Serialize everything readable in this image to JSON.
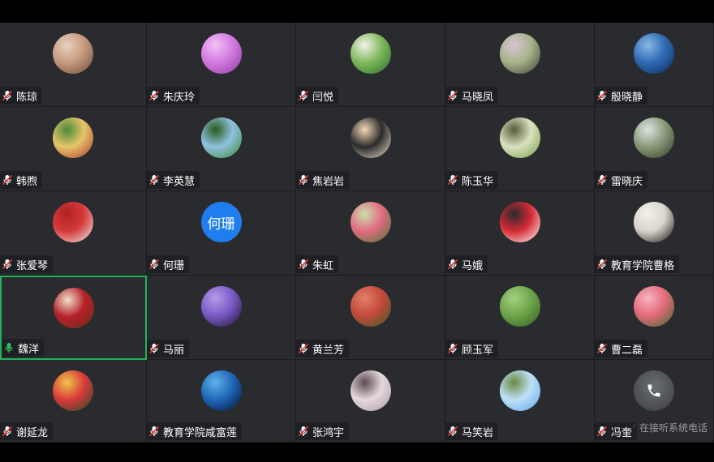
{
  "participants": [
    {
      "name": "陈琼",
      "avatar": {
        "type": "image",
        "colors": [
          "#6b4a3a",
          "#c79a7e",
          "#e8d2c0"
        ]
      },
      "mic": "muted"
    },
    {
      "name": "朱庆玲",
      "avatar": {
        "type": "image",
        "colors": [
          "#8a3aa0",
          "#d37ae0",
          "#f2c2f7"
        ]
      },
      "mic": "muted"
    },
    {
      "name": "闫悦",
      "avatar": {
        "type": "image",
        "colors": [
          "#2b6a2a",
          "#7fb95c",
          "#f4f2ea"
        ]
      },
      "mic": "muted"
    },
    {
      "name": "马晓凤",
      "avatar": {
        "type": "image",
        "colors": [
          "#3a3a3a",
          "#a7b48a",
          "#d8c4d6"
        ]
      },
      "mic": "muted"
    },
    {
      "name": "殷晓静",
      "avatar": {
        "type": "image",
        "colors": [
          "#0b2a5a",
          "#2f6bb3",
          "#89b9e4"
        ]
      },
      "mic": "muted"
    },
    {
      "name": "韩煦",
      "avatar": {
        "type": "image",
        "colors": [
          "#a9382c",
          "#e6c56a",
          "#4c8a3a"
        ]
      },
      "mic": "muted"
    },
    {
      "name": "李英慧",
      "avatar": {
        "type": "image",
        "colors": [
          "#3d8a2b",
          "#8ec1e0",
          "#2a5a1a"
        ]
      },
      "mic": "muted"
    },
    {
      "name": "焦岩岩",
      "avatar": {
        "type": "image",
        "colors": [
          "#f3e4cc",
          "#2b2b2b",
          "#f6d8b8"
        ]
      },
      "mic": "muted"
    },
    {
      "name": "陈玉华",
      "avatar": {
        "type": "image",
        "colors": [
          "#7a9a42",
          "#d9e3c1",
          "#5a5a3a"
        ]
      },
      "mic": "muted"
    },
    {
      "name": "雷晓庆",
      "avatar": {
        "type": "image",
        "colors": [
          "#2c3a22",
          "#8b9a7a",
          "#dbe4e0"
        ]
      },
      "mic": "muted"
    },
    {
      "name": "张爱琴",
      "avatar": {
        "type": "image",
        "colors": [
          "#f1f1f1",
          "#d43a3a",
          "#b02222"
        ]
      },
      "mic": "muted"
    },
    {
      "name": "何珊",
      "avatar": {
        "type": "text",
        "text": "何珊",
        "bg": "#1e7ef0"
      },
      "mic": "muted"
    },
    {
      "name": "朱虹",
      "avatar": {
        "type": "image",
        "colors": [
          "#3e7a2e",
          "#e36a82",
          "#c9e2b0"
        ]
      },
      "mic": "muted"
    },
    {
      "name": "马娥",
      "avatar": {
        "type": "image",
        "colors": [
          "#ffffff",
          "#d52a35",
          "#2b2b2b"
        ]
      },
      "mic": "muted"
    },
    {
      "name": "教育学院曹格",
      "avatar": {
        "type": "image",
        "colors": [
          "#101010",
          "#d9d4cc",
          "#f4f1ec"
        ]
      },
      "mic": "muted"
    },
    {
      "name": "魏洋",
      "avatar": {
        "type": "image",
        "colors": [
          "#6a2f18",
          "#b3202a",
          "#f0e0c8"
        ]
      },
      "mic": "active",
      "active": true
    },
    {
      "name": "马丽",
      "avatar": {
        "type": "image",
        "colors": [
          "#1d1330",
          "#7a5bc6",
          "#b49be8"
        ]
      },
      "mic": "muted"
    },
    {
      "name": "黄兰芳",
      "avatar": {
        "type": "image",
        "colors": [
          "#385a22",
          "#c44a3a",
          "#e27f6a"
        ]
      },
      "mic": "muted"
    },
    {
      "name": "顾玉军",
      "avatar": {
        "type": "image",
        "colors": [
          "#2f5d22",
          "#6ea64a",
          "#a4cf82"
        ]
      },
      "mic": "muted"
    },
    {
      "name": "曹二磊",
      "avatar": {
        "type": "image",
        "colors": [
          "#3a6a2e",
          "#e46a7a",
          "#f5b4c0"
        ]
      },
      "mic": "muted"
    },
    {
      "name": "谢延龙",
      "avatar": {
        "type": "image",
        "colors": [
          "#214a28",
          "#d93a3a",
          "#f0c44a"
        ]
      },
      "mic": "muted"
    },
    {
      "name": "教育学院咸富莲",
      "avatar": {
        "type": "image",
        "colors": [
          "#04102e",
          "#1f67b8",
          "#62b2ea"
        ]
      },
      "mic": "muted"
    },
    {
      "name": "张鸿宇",
      "avatar": {
        "type": "image",
        "colors": [
          "#a89aa4",
          "#e5d8dc",
          "#5a4a52"
        ]
      },
      "mic": "muted"
    },
    {
      "name": "马笑岩",
      "avatar": {
        "type": "image",
        "colors": [
          "#5aa5e8",
          "#bfe0f7",
          "#6a8a42"
        ]
      },
      "mic": "muted"
    },
    {
      "name": "冯奎",
      "avatar": {
        "type": "phone",
        "bg": "#4a4c50"
      },
      "mic": "muted"
    }
  ],
  "overlay": {
    "text": "在接听系统电话"
  },
  "colors": {
    "tile_bg": "#2a2b2f",
    "active_border": "#21b35a",
    "muted_mic": "#d9363e",
    "active_mic": "#2fbf55"
  }
}
